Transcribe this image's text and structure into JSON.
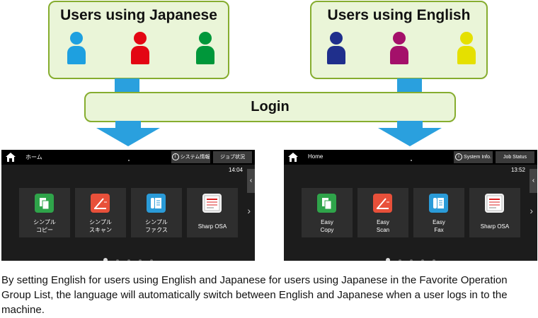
{
  "groups": {
    "japanese": {
      "title": "Users using Japanese",
      "colors": [
        "#1ea0e0",
        "#e30613",
        "#00973a"
      ]
    },
    "english": {
      "title": "Users using English",
      "colors": [
        "#1f2f8c",
        "#a4106a",
        "#e5e000"
      ]
    }
  },
  "login_label": "Login",
  "colors": {
    "arrow": "#2aa0de",
    "box_fill": "#eaf5d8",
    "box_border": "#86ad2f"
  },
  "screens": {
    "japanese": {
      "title": "ホーム",
      "sys_info": "システム情報",
      "job_status": "ジョブ状況",
      "time": "14:04",
      "tiles": [
        "シンプル\nコピー",
        "シンプル\nスキャン",
        "シンプル\nファクス",
        "Sharp OSA"
      ]
    },
    "english": {
      "title": "Home",
      "sys_info": "System Info.",
      "job_status": "Job Status",
      "time": "13:52",
      "tiles": [
        "Easy\nCopy",
        "Easy\nScan",
        "Easy\nFax",
        "Sharp OSA"
      ]
    }
  },
  "caption": "By setting English for users using English and Japanese for users using Japanese in the Favorite Operation Group List, the language will automatically switch between English and Japanese when a user logs in to the machine."
}
